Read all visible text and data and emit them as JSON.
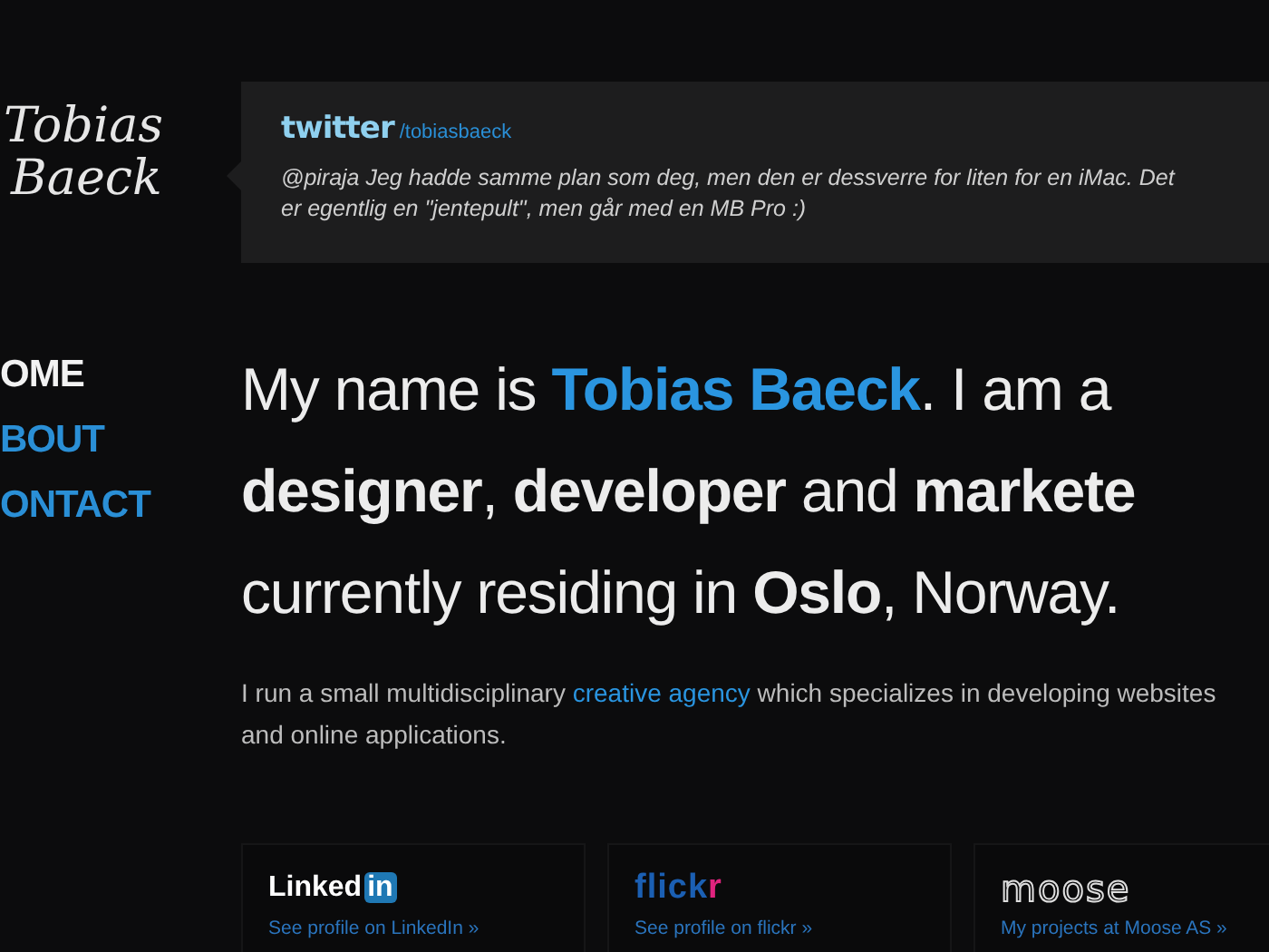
{
  "logo": {
    "line_1": "Tobias",
    "line_2": "Baeck"
  },
  "nav": [
    {
      "label": "OME",
      "selected": true
    },
    {
      "label": "BOUT",
      "selected": false
    },
    {
      "label": "ONTACT",
      "selected": false
    }
  ],
  "twitter": {
    "brand": "twitter",
    "handle": "/tobiasbaeck",
    "tweet": "@piraja Jeg hadde samme plan som deg, men den er dessverre for liten for en iMac. Det er egentlig en \"jentepult\", men går med en MB Pro :)"
  },
  "headline": [
    {
      "text": "My name is **Tobias Baeck**. I am a",
      "kind": "accent"
    },
    {
      "text": "**designer**, **developer** and **markete**",
      "kind": "strong"
    },
    {
      "text": "currently residing in **Oslo**, Norway.",
      "kind": "strong"
    }
  ],
  "intro": {
    "before": "I run a small multidisciplinary ",
    "link": "creative agency",
    "after": " which specializes in developing websites and online applications."
  },
  "profiles": [
    {
      "kind": "linkedin",
      "logo": "Linked",
      "logo_badge": "in",
      "link": "See profile on LinkedIn »"
    },
    {
      "kind": "flickr",
      "logo": "flick",
      "logo_badge": "r",
      "link": "See profile on flickr »"
    },
    {
      "kind": "moose",
      "logo": "moose",
      "link": "My projects at Moose AS »"
    }
  ]
}
